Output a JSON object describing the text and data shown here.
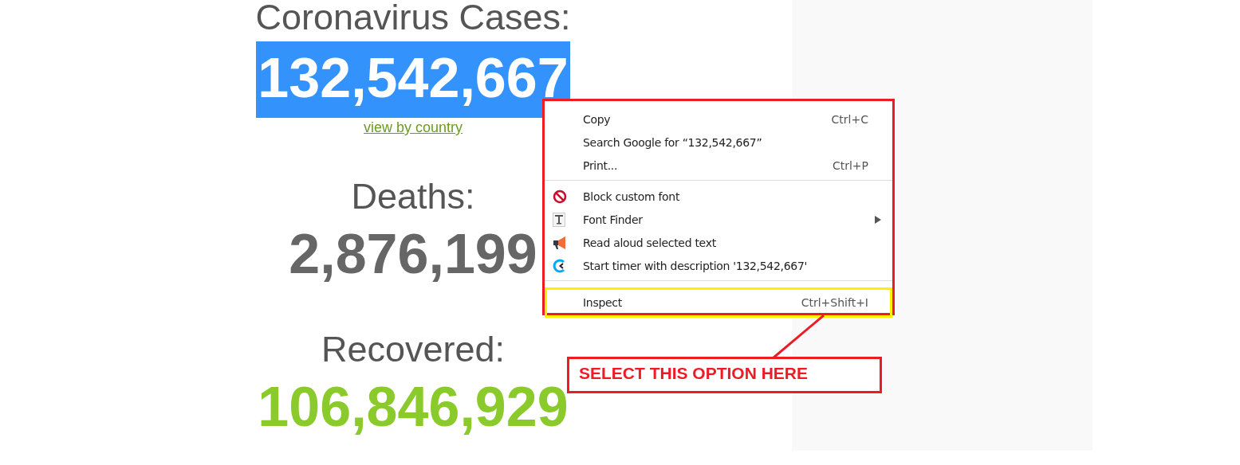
{
  "stats": [
    {
      "kind": "cases",
      "heading": "Coronavirus Cases:",
      "value": "132,542,667",
      "selected": true,
      "link": "view by country"
    },
    {
      "kind": "deaths",
      "heading": "Deaths:",
      "value": "2,876,199",
      "selected": false
    },
    {
      "kind": "recovered",
      "heading": "Recovered:",
      "value": "106,846,929",
      "selected": false
    }
  ],
  "context_menu": {
    "items": [
      {
        "kind": "plain",
        "label": "Copy",
        "shortcut": "Ctrl+C"
      },
      {
        "kind": "plain",
        "label": "Search Google for “132,542,667”"
      },
      {
        "kind": "plain",
        "label": "Print...",
        "shortcut": "Ctrl+P"
      },
      {
        "kind": "separator"
      },
      {
        "kind": "block",
        "label": "Block custom font"
      },
      {
        "kind": "font",
        "label": "Font Finder",
        "submenu": true
      },
      {
        "kind": "megaphone",
        "label": "Read aloud selected text"
      },
      {
        "kind": "timer",
        "label": "Start timer with description '132,542,667'"
      },
      {
        "kind": "separator"
      },
      {
        "kind": "plain",
        "label": "Inspect",
        "shortcut": "Ctrl+Shift+I",
        "highlighted": true
      }
    ]
  },
  "callout": {
    "text": "SELECT THIS OPTION HERE"
  }
}
